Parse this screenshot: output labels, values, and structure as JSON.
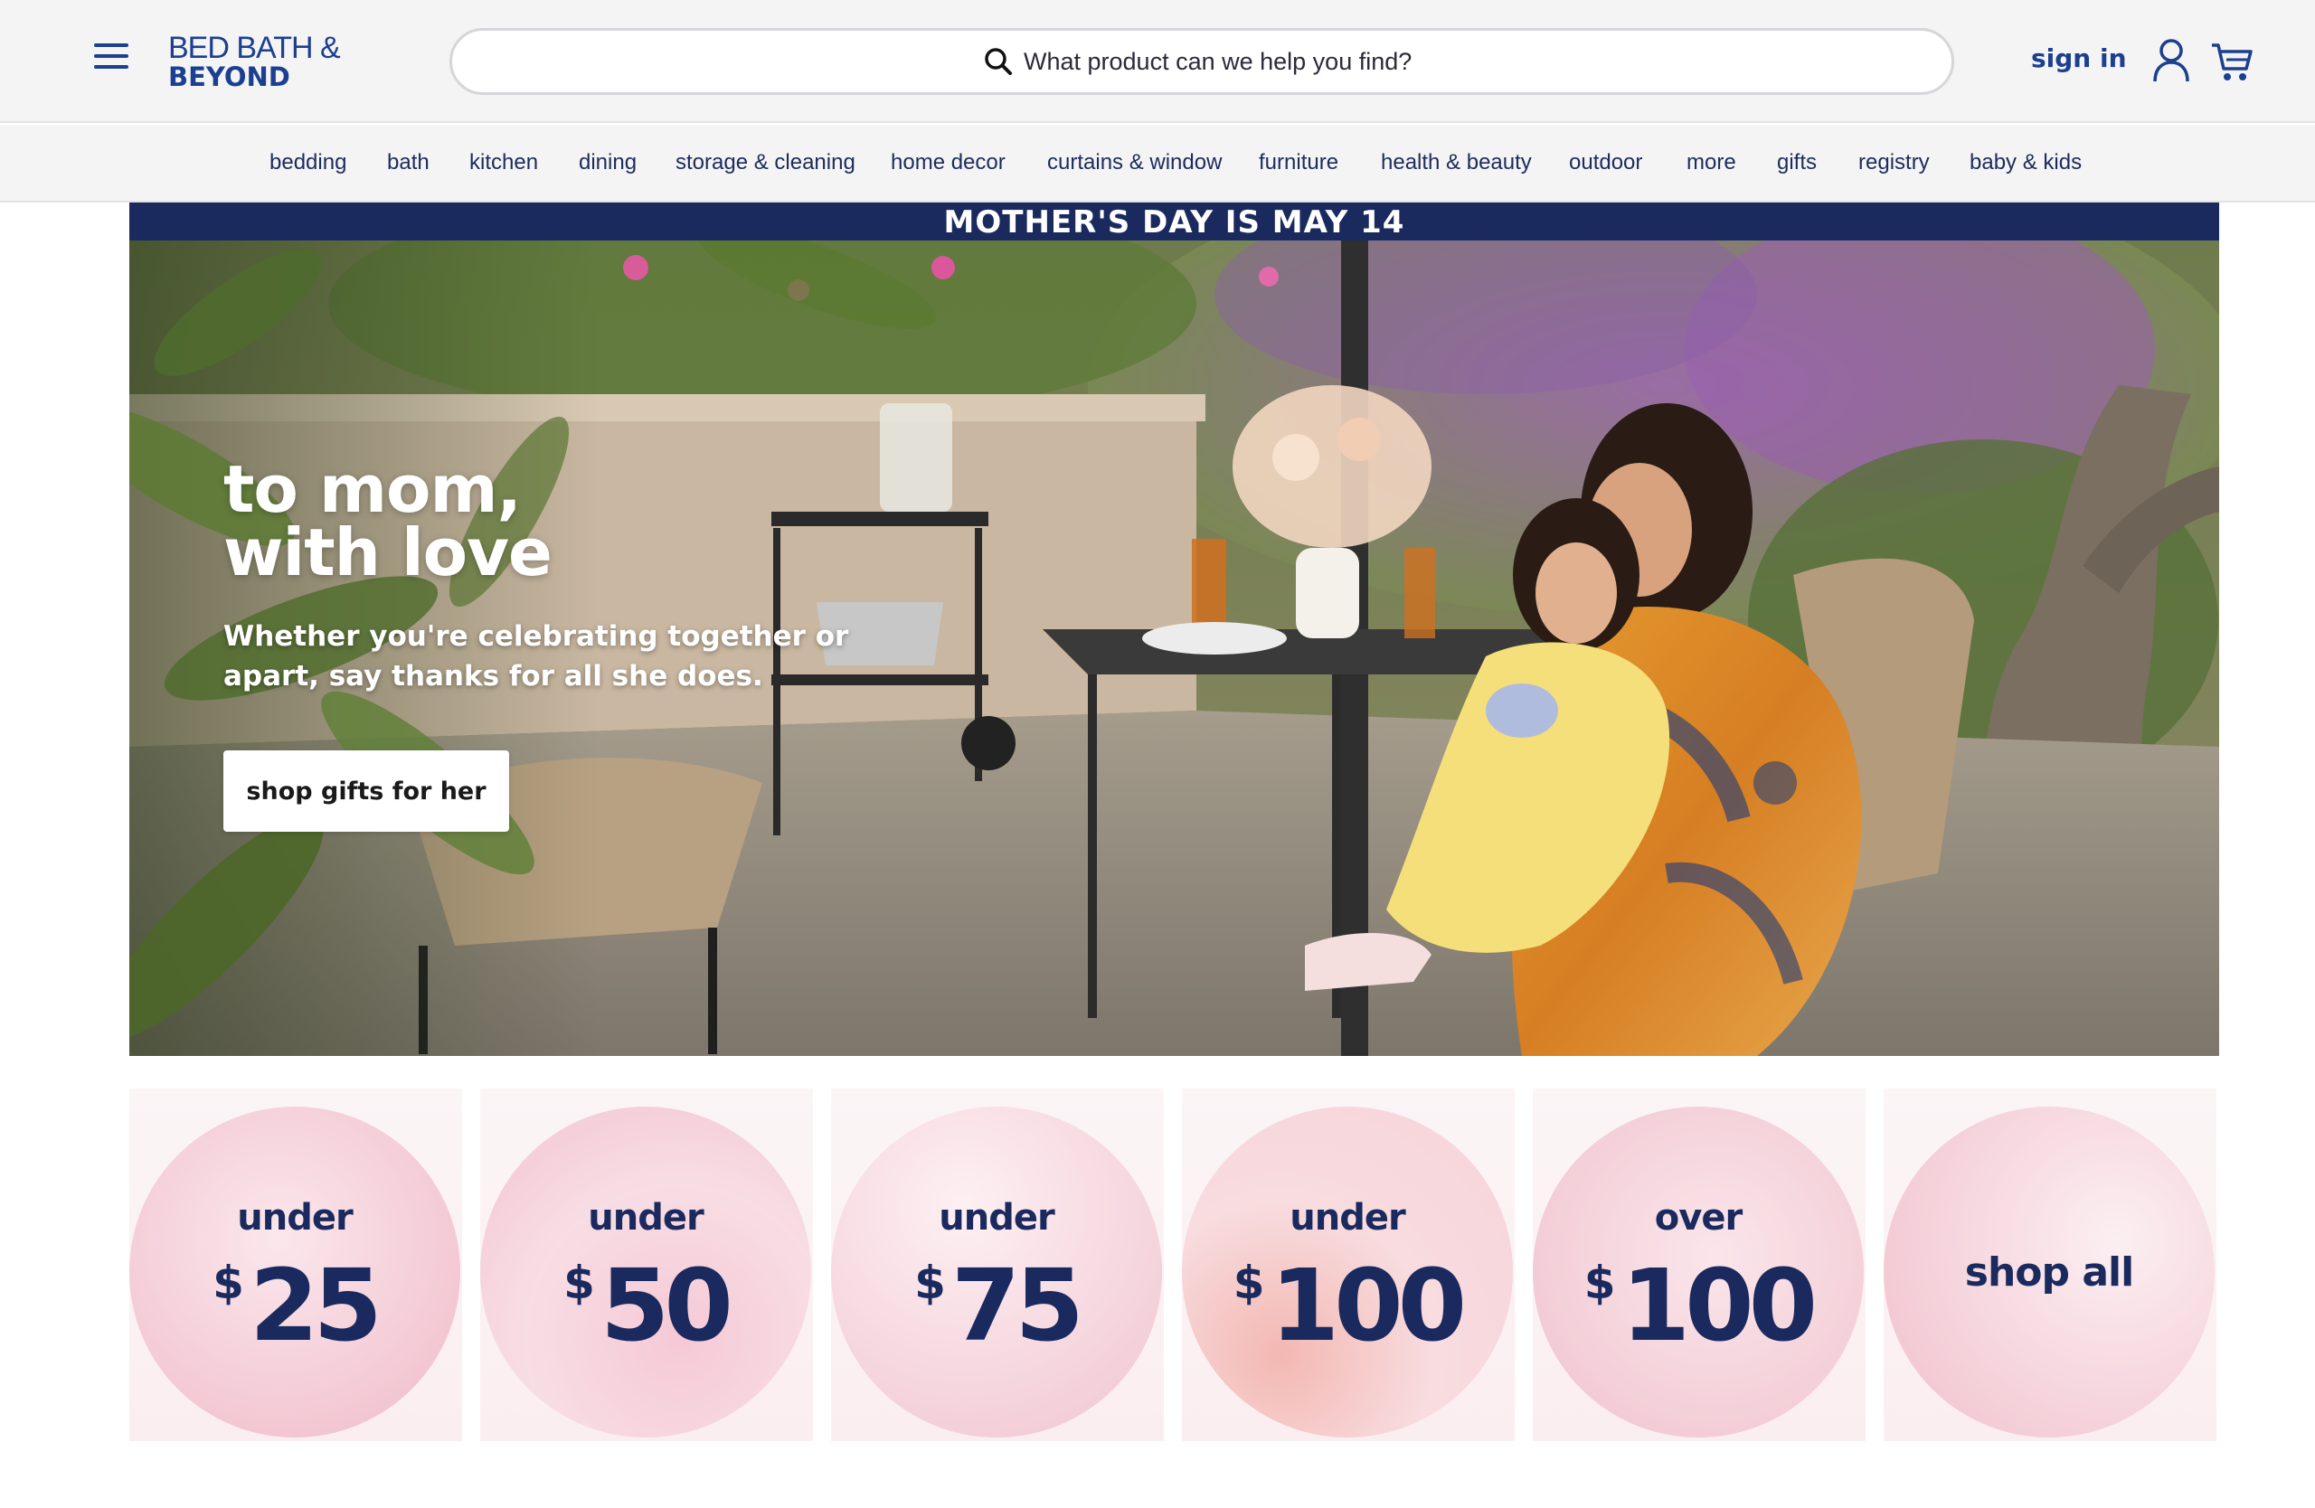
{
  "header": {
    "logo_line1": "BED BATH &",
    "logo_line2": "BEYOND",
    "search_placeholder": "What product can we help you find?",
    "sign_in": "sign in"
  },
  "nav": {
    "items": [
      "bedding",
      "bath",
      "kitchen",
      "dining",
      "storage & cleaning",
      "home decor",
      "curtains & window",
      "furniture",
      "health & beauty",
      "outdoor",
      "more",
      "gifts",
      "registry",
      "baby & kids"
    ]
  },
  "hero": {
    "promo": "MOTHER'S DAY IS MAY 14",
    "title": "to mom,\nwith love",
    "subtitle": "Whether you're celebrating together or apart, say thanks for all she does.",
    "button": "shop gifts for her"
  },
  "price_tiles": [
    {
      "top": "under",
      "amount": "25",
      "currency": "$"
    },
    {
      "top": "under",
      "amount": "50",
      "currency": "$"
    },
    {
      "top": "under",
      "amount": "75",
      "currency": "$"
    },
    {
      "top": "under",
      "amount": "100",
      "currency": "$"
    },
    {
      "top": "over",
      "amount": "100",
      "currency": "$"
    },
    {
      "label": "shop all"
    }
  ],
  "colors": {
    "brand_navy": "#1b2a5e",
    "brand_blue": "#1d3f8f",
    "header_bg": "#f4f4f5",
    "tile_pink": "#f6d3dc"
  },
  "icons": {
    "menu": "hamburger-menu-icon",
    "search": "search-icon",
    "account": "user-icon",
    "cart": "cart-icon"
  }
}
